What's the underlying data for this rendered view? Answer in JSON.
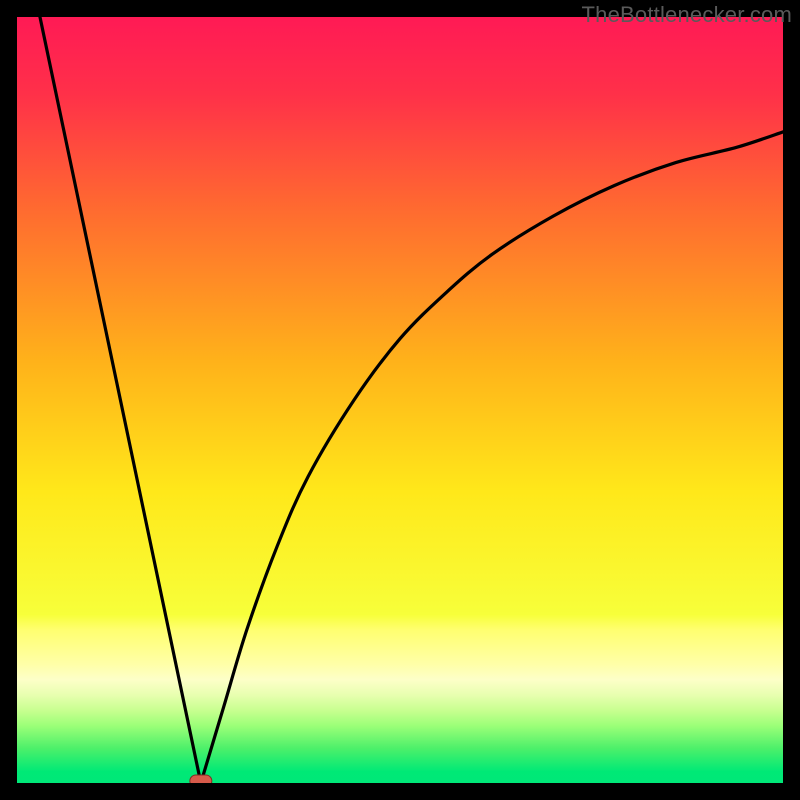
{
  "attribution": "TheBottlenecker.com",
  "colors": {
    "black": "#000000",
    "curve": "#000000",
    "marker_fill": "#d65a4a",
    "marker_stroke": "#7a2f26",
    "gradient_stops": [
      {
        "offset": 0.0,
        "color": "#ff1a55"
      },
      {
        "offset": 0.1,
        "color": "#ff3049"
      },
      {
        "offset": 0.25,
        "color": "#ff6a30"
      },
      {
        "offset": 0.45,
        "color": "#ffb21a"
      },
      {
        "offset": 0.62,
        "color": "#ffe81a"
      },
      {
        "offset": 0.78,
        "color": "#f7ff3a"
      },
      {
        "offset": 0.8,
        "color": "#ffff70"
      },
      {
        "offset": 0.845,
        "color": "#ffffa8"
      },
      {
        "offset": 0.865,
        "color": "#fdffc8"
      },
      {
        "offset": 0.885,
        "color": "#e8ffb0"
      },
      {
        "offset": 0.905,
        "color": "#c8ff90"
      },
      {
        "offset": 0.925,
        "color": "#9cff78"
      },
      {
        "offset": 0.955,
        "color": "#4cf06a"
      },
      {
        "offset": 0.985,
        "color": "#00e976"
      },
      {
        "offset": 1.0,
        "color": "#00e878"
      }
    ]
  },
  "chart_data": {
    "type": "line",
    "title": "",
    "xlabel": "",
    "ylabel": "",
    "xlim": [
      0,
      100
    ],
    "ylim": [
      0,
      100
    ],
    "notes": "Bottleneck-style curve: V-shape touching y≈0 near x≈24; left arm rises steeply to y=100 at x≈3; right arm rises with diminishing slope toward ~85 at x=100. Background is a vertical heat gradient red→yellow→green.",
    "series": [
      {
        "name": "curve",
        "x": [
          3,
          6,
          9,
          12,
          15,
          18,
          21,
          24,
          27,
          30,
          34,
          38,
          44,
          50,
          56,
          62,
          70,
          78,
          86,
          94,
          100
        ],
        "y": [
          100,
          86,
          71,
          57,
          43,
          28,
          14,
          0,
          10,
          20,
          31,
          40,
          50,
          58,
          64,
          69,
          74,
          78,
          81,
          83,
          85
        ]
      }
    ],
    "marker": {
      "x": 24,
      "y": 0
    }
  }
}
